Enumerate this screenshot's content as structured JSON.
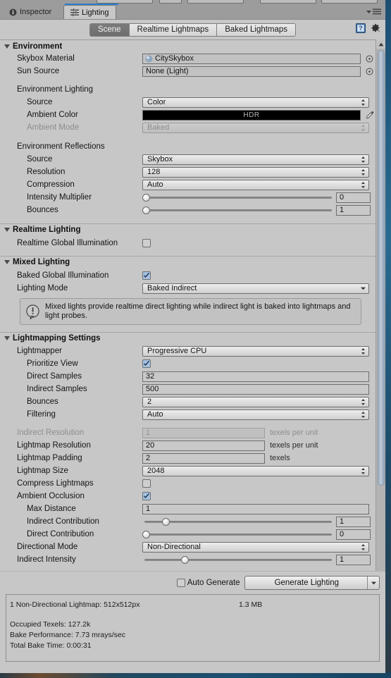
{
  "window": {
    "tabs": [
      {
        "label": "Inspector",
        "icon": "info-icon",
        "active": false
      },
      {
        "label": "Lighting",
        "icon": "lighting-icon",
        "active": true
      }
    ],
    "menu_icon": "hamburger-menu-icon",
    "help_icon": "help-book-icon",
    "settings_icon": "gear-icon"
  },
  "modebar": {
    "segments": [
      {
        "label": "Scene",
        "selected": true
      },
      {
        "label": "Realtime Lightmaps",
        "selected": false
      },
      {
        "label": "Baked Lightmaps",
        "selected": false
      }
    ]
  },
  "environment": {
    "title": "Environment",
    "skybox_material": {
      "label": "Skybox Material",
      "value": "CitySkybox",
      "icon": "material-sphere-icon",
      "picker": "object-picker-icon"
    },
    "sun_source": {
      "label": "Sun Source",
      "value": "None (Light)",
      "picker": "object-picker-icon"
    },
    "environment_lighting": {
      "group_label": "Environment Lighting",
      "source": {
        "label": "Source",
        "value": "Color"
      },
      "ambient_color": {
        "label": "Ambient Color",
        "value": "HDR",
        "swatch": "#000000",
        "eyedropper": "eyedropper-icon"
      },
      "ambient_mode": {
        "label": "Ambient Mode",
        "value": "Baked",
        "disabled": true
      }
    },
    "environment_reflections": {
      "group_label": "Environment Reflections",
      "source": {
        "label": "Source",
        "value": "Skybox"
      },
      "resolution": {
        "label": "Resolution",
        "value": "128"
      },
      "compression": {
        "label": "Compression",
        "value": "Auto"
      },
      "intensity_multiplier": {
        "label": "Intensity Multiplier",
        "value": "0",
        "fill": 0
      },
      "bounces": {
        "label": "Bounces",
        "value": "1",
        "fill": 0
      }
    }
  },
  "realtime_lighting": {
    "title": "Realtime Lighting",
    "realtime_gi": {
      "label": "Realtime Global Illumination",
      "checked": false
    }
  },
  "mixed_lighting": {
    "title": "Mixed Lighting",
    "baked_gi": {
      "label": "Baked Global Illumination",
      "checked": true
    },
    "lighting_mode": {
      "label": "Lighting Mode",
      "value": "Baked Indirect"
    },
    "help": {
      "icon": "info-circle-icon",
      "text": "Mixed lights provide realtime direct lighting while indirect light is baked into lightmaps and light probes."
    }
  },
  "lightmapping_settings": {
    "title": "Lightmapping Settings",
    "lightmapper": {
      "label": "Lightmapper",
      "value": "Progressive CPU"
    },
    "prioritize_view": {
      "label": "Prioritize View",
      "checked": true
    },
    "direct_samples": {
      "label": "Direct Samples",
      "value": "32"
    },
    "indirect_samples": {
      "label": "Indirect Samples",
      "value": "500"
    },
    "bounces": {
      "label": "Bounces",
      "value": "2"
    },
    "filtering": {
      "label": "Filtering",
      "value": "Auto"
    },
    "indirect_resolution": {
      "label": "Indirect Resolution",
      "value": "1",
      "units": "texels per unit",
      "disabled": true
    },
    "lightmap_resolution": {
      "label": "Lightmap Resolution",
      "value": "20",
      "units": "texels per unit"
    },
    "lightmap_padding": {
      "label": "Lightmap Padding",
      "value": "2",
      "units": "texels"
    },
    "lightmap_size": {
      "label": "Lightmap Size",
      "value": "2048"
    },
    "compress_lightmaps": {
      "label": "Compress Lightmaps",
      "checked": false
    },
    "ambient_occlusion": {
      "label": "Ambient Occlusion",
      "checked": true
    },
    "max_distance": {
      "label": "Max Distance",
      "value": "1"
    },
    "indirect_contribution": {
      "label": "Indirect Contribution",
      "value": "1",
      "fill": 0.24
    },
    "direct_contribution": {
      "label": "Direct Contribution",
      "value": "0",
      "fill": 0
    },
    "directional_mode": {
      "label": "Directional Mode",
      "value": "Non-Directional"
    },
    "indirect_intensity": {
      "label": "Indirect Intensity",
      "value": "1",
      "fill": 0.24
    }
  },
  "bottom": {
    "auto_generate": {
      "label": "Auto Generate",
      "checked": false
    },
    "generate_button": {
      "label": "Generate Lighting",
      "dropdown": "chevron-down-icon"
    }
  },
  "stats": {
    "lightmap_line": "1 Non-Directional Lightmap: 512x512px",
    "lightmap_size": "1.3 MB",
    "occupied_texels": "Occupied Texels: 127.2k",
    "bake_performance": "Bake Performance: 7.73 mrays/sec",
    "total_bake_time": "Total Bake Time: 0:00:31"
  },
  "colors": {
    "panel": "#c7c7c7",
    "chrome": "#9c9c9c",
    "accent": "#2c7fd0",
    "selected_seg": "#6e6e6e"
  }
}
